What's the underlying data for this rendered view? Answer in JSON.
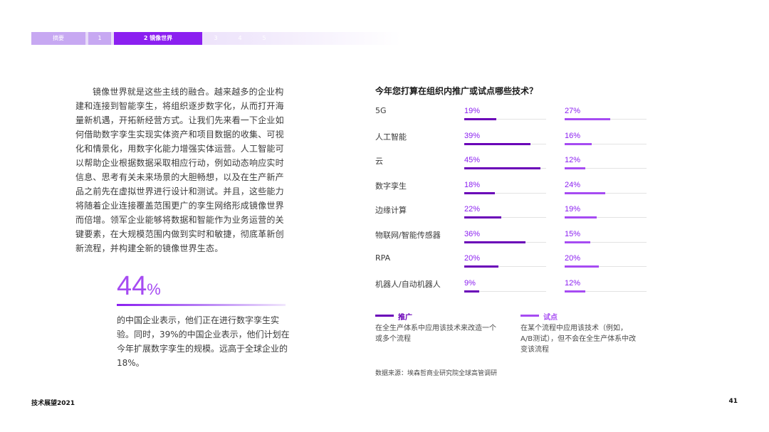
{
  "nav": {
    "tabs": [
      {
        "label": "摘要"
      },
      {
        "label": "1"
      },
      {
        "label": "2 镜像世界"
      },
      {
        "label": "3"
      },
      {
        "label": "4"
      },
      {
        "label": "5"
      }
    ]
  },
  "body": {
    "paragraph": "镜像世界就是这些主线的融合。越来越多的企业构建和连接到智能孪生，将组织逐步数字化，从而打开海量新机遇，开拓新经营方式。让我们先来看一下企业如何借助数字孪生实现实体资产和项目数据的收集、可视化和情景化，用数字化能力增强实体运营。人工智能可以帮助企业根据数据采取相应行动，例如动态响应实时信息、思考有关未来场景的大胆畅想，以及在生产新产品之前先在虚拟世界进行设计和测试。并且，这些能力将随着企业连接覆盖范围更广的孪生网络形成镜像世界而倍增。领军企业能够将数据和智能作为业务运营的关键要素，在大规模范围内做到实时和敏捷，彻底革新创新流程，并构建全新的镜像世界生态。",
    "stat_value": "44",
    "stat_unit": "%",
    "stat_text": "的中国企业表示，他们正在进行数字孪生实验。同时，39%的中国企业表示，他们计划在今年扩展数字孪生的规模。远高于全球企业的18%。"
  },
  "chart_data": {
    "type": "bar",
    "title": "今年您打算在组织内推广或试点哪些技术？",
    "categories": [
      "5G",
      "人工智能",
      "云",
      "数字孪生",
      "边缘计算",
      "物联网/智能传感器",
      "RPA",
      "机器人/自动机器人"
    ],
    "series": [
      {
        "name": "推广",
        "values": [
          19,
          39,
          45,
          18,
          22,
          36,
          20,
          9
        ],
        "labels": [
          "19%",
          "39%",
          "45%",
          "18%",
          "22%",
          "36%",
          "20%",
          "9%"
        ],
        "color": "#6a00b8"
      },
      {
        "name": "试点",
        "values": [
          27,
          16,
          12,
          24,
          19,
          15,
          20,
          12
        ],
        "labels": [
          "27%",
          "16%",
          "12%",
          "24%",
          "19%",
          "15%",
          "20%",
          "12%"
        ],
        "color": "#a64bf2"
      }
    ],
    "xlim": [
      0,
      50
    ]
  },
  "legend": {
    "promote": {
      "label": "推广",
      "desc": "在全生产体系中应用该技术来改造一个或多个流程"
    },
    "pilot": {
      "label": "试点",
      "desc": "在某个流程中应用该技术（例如，A/B测试），但不会在全生产体系中改变该流程"
    }
  },
  "source": "数据来源：埃森哲商业研究院全球高管调研",
  "footer": {
    "left": "技术展望2021",
    "page": "41"
  }
}
